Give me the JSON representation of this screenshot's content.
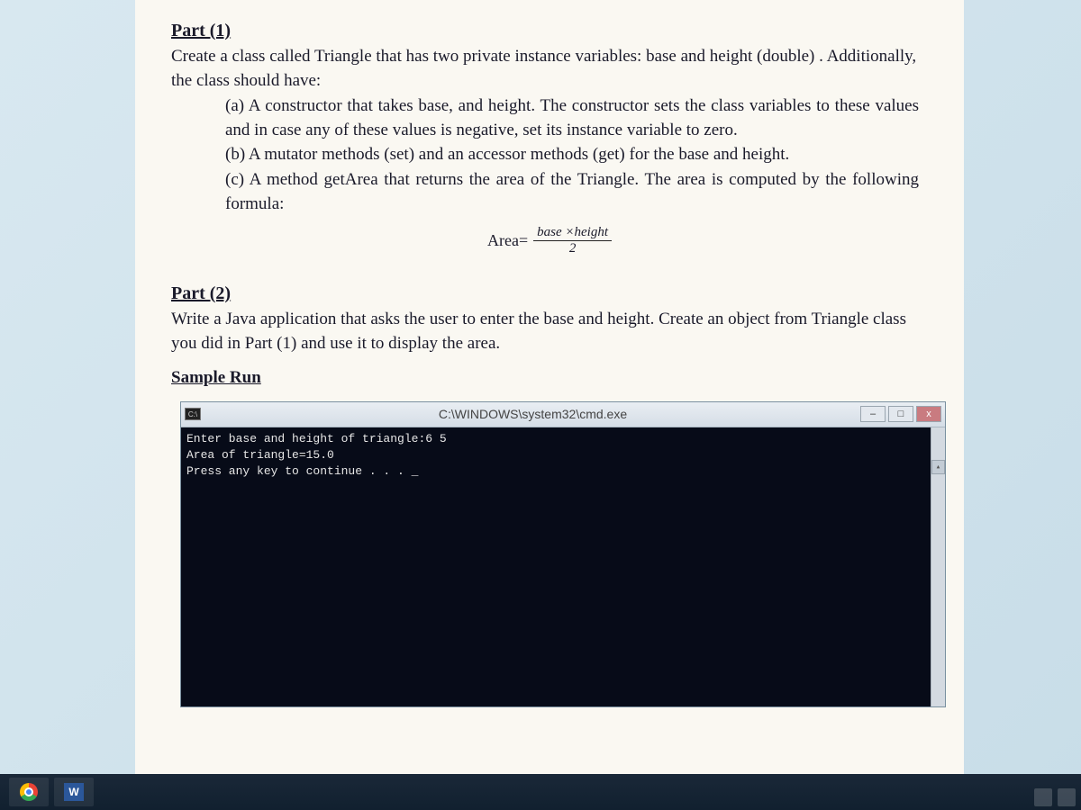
{
  "part1": {
    "heading": "Part (1)",
    "intro": "Create a class called Triangle that has two private instance variables: base and height (double) . Additionally, the class should have:",
    "items": {
      "a": "(a) A constructor that takes base, and height. The constructor sets the class variables to these values and in case any of these values is negative, set its instance variable to zero.",
      "b": "(b) A mutator methods (set) and an accessor methods (get) for the base and height.",
      "c": "(c) A method getArea that returns the area of the Triangle. The area is computed by the following formula:"
    },
    "formula": {
      "lhs": "Area=",
      "numerator": "base ×height",
      "denominator": "2"
    }
  },
  "part2": {
    "heading": "Part (2)",
    "text": "Write a Java application that asks the user to enter the base and height. Create an object from Triangle class you did in Part (1) and use it to display the area.",
    "sample_heading": "Sample Run"
  },
  "cmd": {
    "icon_label": "C:\\",
    "title": "C:\\WINDOWS\\system32\\cmd.exe",
    "minimize": "–",
    "maximize": "□",
    "close": "x",
    "lines": "Enter base and height of triangle:6 5\nArea of triangle=15.0\nPress any key to continue . . . _",
    "scroll_up": "▴"
  },
  "taskbar": {
    "word_label": "W"
  }
}
